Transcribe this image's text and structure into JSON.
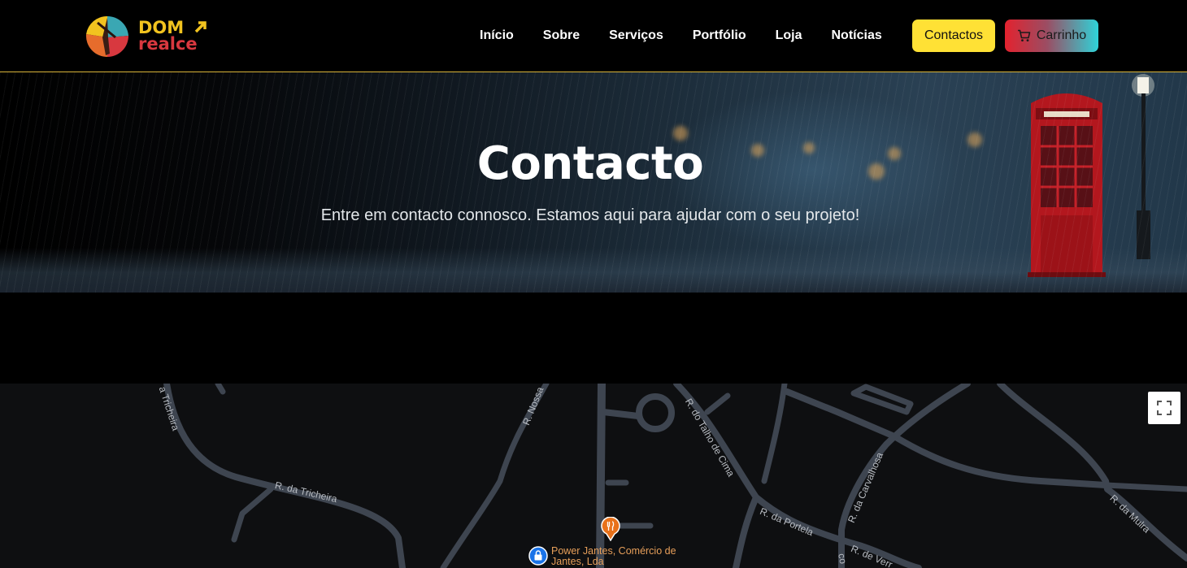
{
  "brand": {
    "line1": "DOM",
    "line2": "realce"
  },
  "nav": {
    "items": [
      "Início",
      "Sobre",
      "Serviços",
      "Portfólio",
      "Loja",
      "Notícias"
    ],
    "contact_label": "Contactos",
    "cart_label": "Carrinho"
  },
  "hero": {
    "title": "Contacto",
    "subtitle": "Entre em contacto connosco. Estamos aqui para ajudar com o seu projeto!"
  },
  "map": {
    "streets": [
      "a Tricheira",
      "R. da Tricheira",
      "R. Nossa",
      "R. do Talho de Cima",
      "R. da Carvalhosa",
      "R. da Portela",
      "R. de Verr",
      "R. da Mulra",
      "co"
    ],
    "poi": "Power Jantes, Comércio de Jantes, Lda"
  },
  "colors": {
    "accent_yellow": "#ffe135",
    "header_border": "#d9b43a",
    "cart_gradient_start": "#e3222e",
    "cart_gradient_end": "#2fd3d8",
    "map_background": "#0e0f11",
    "road": "#3e4550",
    "poi_text": "#e79f5a"
  },
  "icons": [
    "cart-icon",
    "fullscreen-icon",
    "restaurant-pin-icon",
    "shop-pin-icon"
  ]
}
